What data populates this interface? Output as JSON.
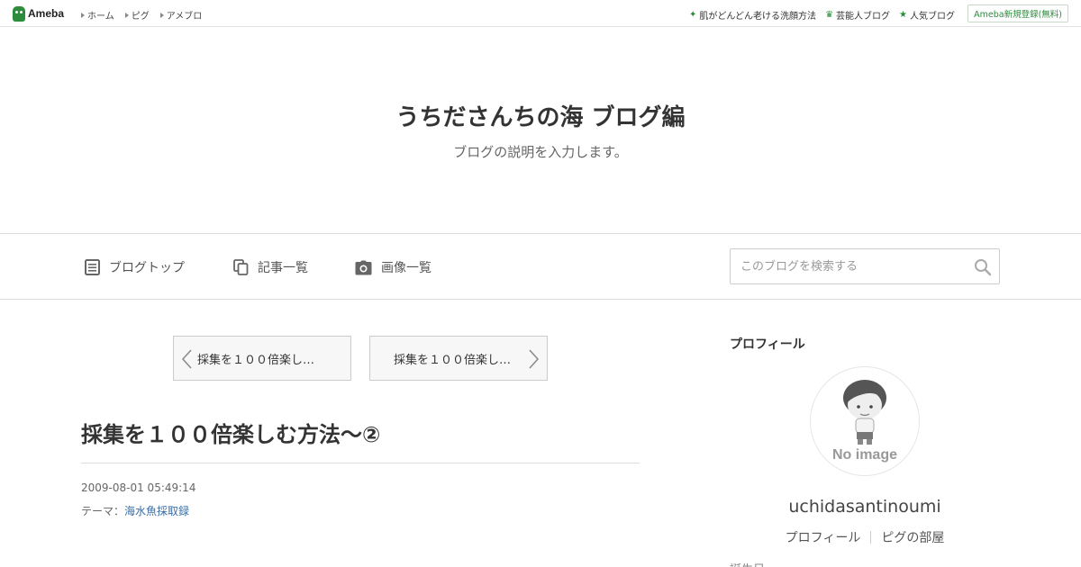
{
  "topbar": {
    "logo_text": "Ameba",
    "nav": [
      {
        "label": "ホーム"
      },
      {
        "label": "ピグ"
      },
      {
        "label": "アメブロ"
      }
    ],
    "links": [
      {
        "label": "肌がどんどん老ける洗顔方法",
        "icon": "sparkle-icon"
      },
      {
        "label": "芸能人ブログ",
        "icon": "crown-icon"
      },
      {
        "label": "人気ブログ",
        "icon": "star-icon"
      }
    ],
    "register_label": "Ameba新規登録(無料)"
  },
  "header": {
    "title": "うちださんちの海 ブログ編",
    "description": "ブログの説明を入力します。"
  },
  "nav": {
    "items": [
      {
        "label": "ブログトップ",
        "icon": "document-icon"
      },
      {
        "label": "記事一覧",
        "icon": "copy-icon"
      },
      {
        "label": "画像一覧",
        "icon": "camera-icon"
      }
    ],
    "search_placeholder": "このブログを検索する"
  },
  "pager": {
    "prev_label": "採集を１００倍楽し…",
    "next_label": "採集を１００倍楽し…"
  },
  "entry": {
    "title": "採集を１００倍楽しむ方法～②",
    "date": "2009-08-01 05:49:14",
    "theme_label": "テーマ：",
    "theme_value": "海水魚採取録"
  },
  "sidebar": {
    "heading": "プロフィール",
    "avatar_text": "No image",
    "name": "uchidasantinoumi",
    "links": [
      {
        "label": "プロフィール"
      },
      {
        "label": "ピグの部屋"
      }
    ],
    "cut_text": "誕生日"
  },
  "colors": {
    "brand_green": "#2d8c3c",
    "link_blue": "#3a6ea5"
  }
}
